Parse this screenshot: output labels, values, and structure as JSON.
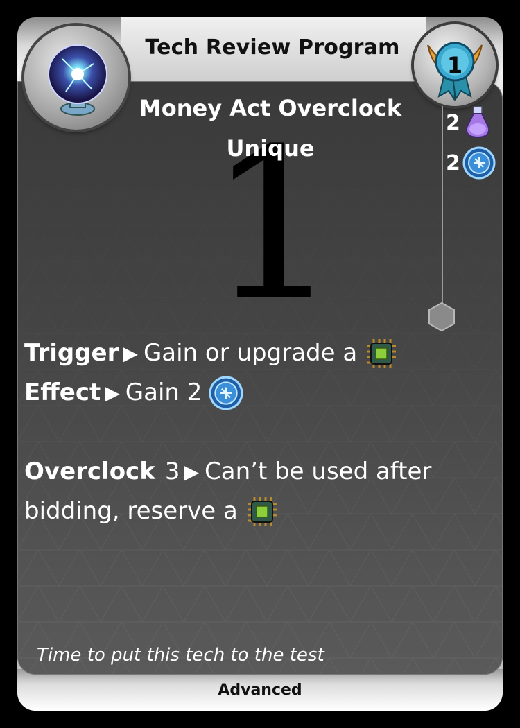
{
  "card": {
    "title": "Tech Review Program",
    "name": "Money Act Overclock",
    "tag": "Unique",
    "big_number": "1",
    "rank": "1",
    "costs": [
      {
        "amount": "2",
        "icon": "potion-icon"
      },
      {
        "amount": "2",
        "icon": "blue-coin-icon"
      }
    ],
    "rules": {
      "trigger_label": "Trigger",
      "trigger_text": "Gain or upgrade a",
      "effect_label": "Effect",
      "effect_text": "Gain 2",
      "overclock_label": "Overclock",
      "overclock_value": "3",
      "overclock_text": "Can’t be used after",
      "overclock_text2": "bidding, reserve a"
    },
    "flavor": "Time to put this tech to the test",
    "rarity": "Advanced",
    "arrow_glyph": "▶"
  }
}
